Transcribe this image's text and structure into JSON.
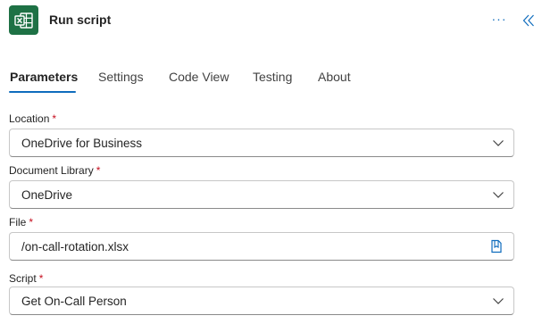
{
  "header": {
    "title": "Run script",
    "app_icon": "excel-icon",
    "more_label": "···",
    "collapse_icon": "double-chevron-left-icon"
  },
  "tabs": [
    {
      "label": "Parameters",
      "active": true
    },
    {
      "label": "Settings",
      "active": false
    },
    {
      "label": "Code View",
      "active": false
    },
    {
      "label": "Testing",
      "active": false
    },
    {
      "label": "About",
      "active": false
    }
  ],
  "fields": {
    "location": {
      "label": "Location",
      "required_mark": "*",
      "value": "OneDrive for Business",
      "icon": "chevron-down-icon"
    },
    "document_library": {
      "label": "Document Library",
      "required_mark": "*",
      "value": "OneDrive",
      "icon": "chevron-down-icon"
    },
    "file": {
      "label": "File",
      "required_mark": "*",
      "value": "/on-call-rotation.xlsx",
      "icon": "file-picker-icon"
    },
    "script": {
      "label": "Script",
      "required_mark": "*",
      "value": "Get On-Call Person",
      "icon": "chevron-down-icon"
    }
  },
  "colors": {
    "accent": "#0f6cbd",
    "excel_green": "#1e7145",
    "required": "#c50f1f",
    "border": "#c7c7c7"
  }
}
